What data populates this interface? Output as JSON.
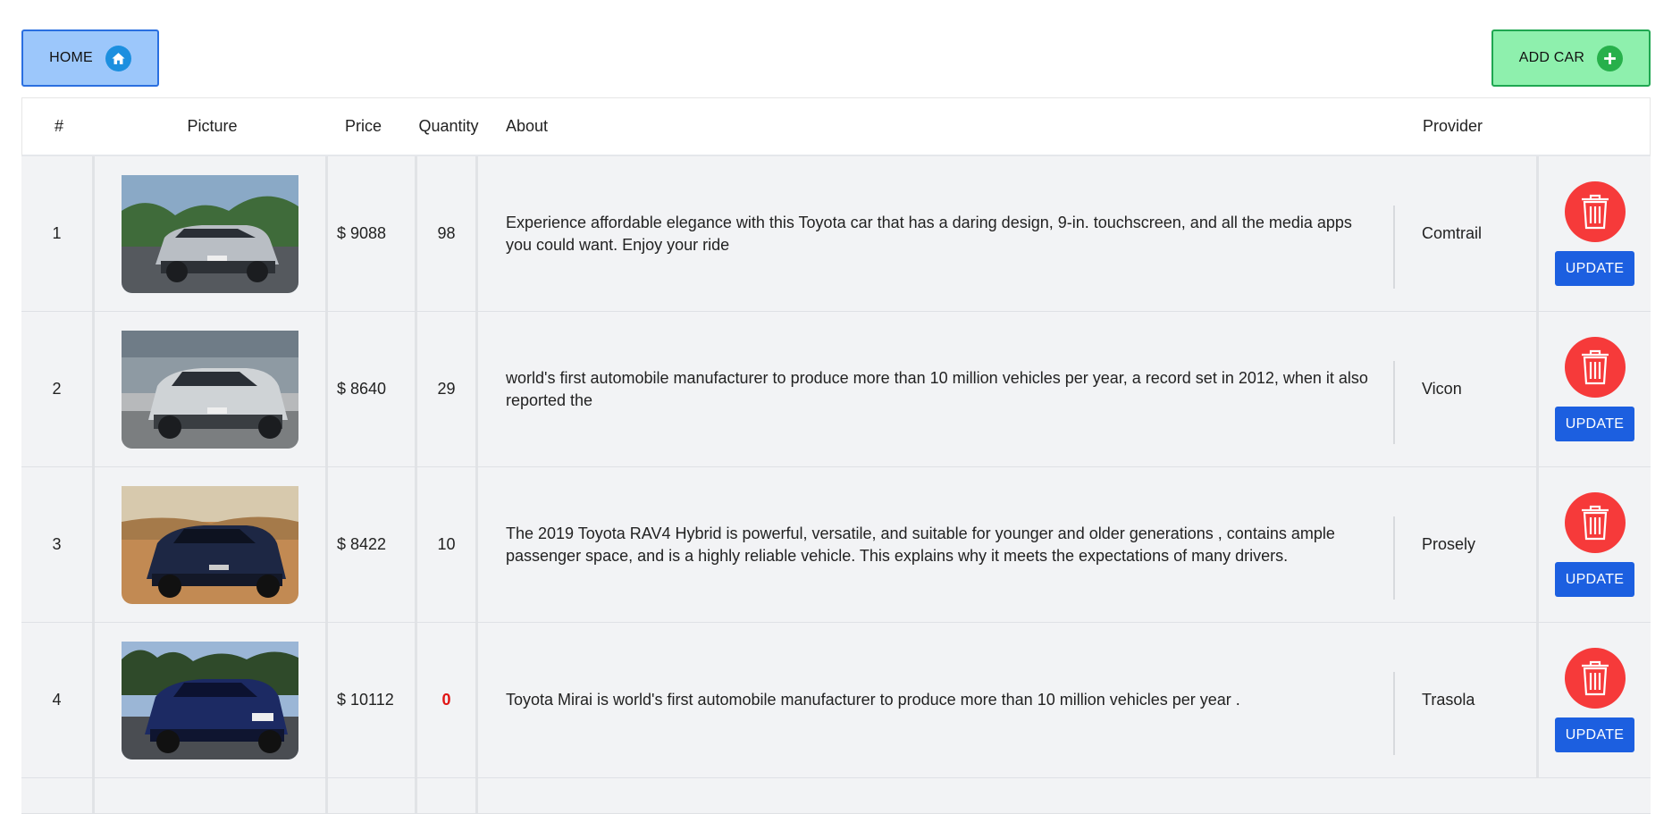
{
  "toolbar": {
    "home_label": "HOME",
    "add_label": "ADD CAR"
  },
  "table": {
    "columns": [
      "#",
      "Picture",
      "Price",
      "Quantity",
      "About",
      "Provider"
    ],
    "delete_icon": "trash-icon",
    "update_label": "UPDATE",
    "rows": [
      {
        "num": "1",
        "price": "$ 9088",
        "qty": "98",
        "about": "Experience affordable elegance with this Toyota car that has a daring design, 9-in. touchscreen, and all the media apps you could want. Enjoy your ride",
        "provider": "Comtrail"
      },
      {
        "num": "2",
        "price": "$ 8640",
        "qty": "29",
        "about": "world's first automobile manufacturer to produce more than 10 million vehicles per year, a record set in 2012, when it also reported the",
        "provider": "Vicon"
      },
      {
        "num": "3",
        "price": "$ 8422",
        "qty": "10",
        "about": "The 2019 Toyota RAV4 Hybrid is powerful, versatile, and suitable for younger and older generations , contains ample passenger space, and is a highly reliable vehicle. This explains why it meets the expectations of many drivers.",
        "provider": "Prosely"
      },
      {
        "num": "4",
        "price": "$ 10112",
        "qty": "0",
        "about": "Toyota Mirai is world's first automobile manufacturer to produce more than 10 million vehicles per year .",
        "provider": "Trasola"
      }
    ]
  },
  "colors": {
    "home_bg": "#9cc7fb",
    "add_bg": "#8ef0ad",
    "delete_red": "#f63a3a",
    "update_blue": "#1c5fe0",
    "zero_qty": "#e01414"
  }
}
